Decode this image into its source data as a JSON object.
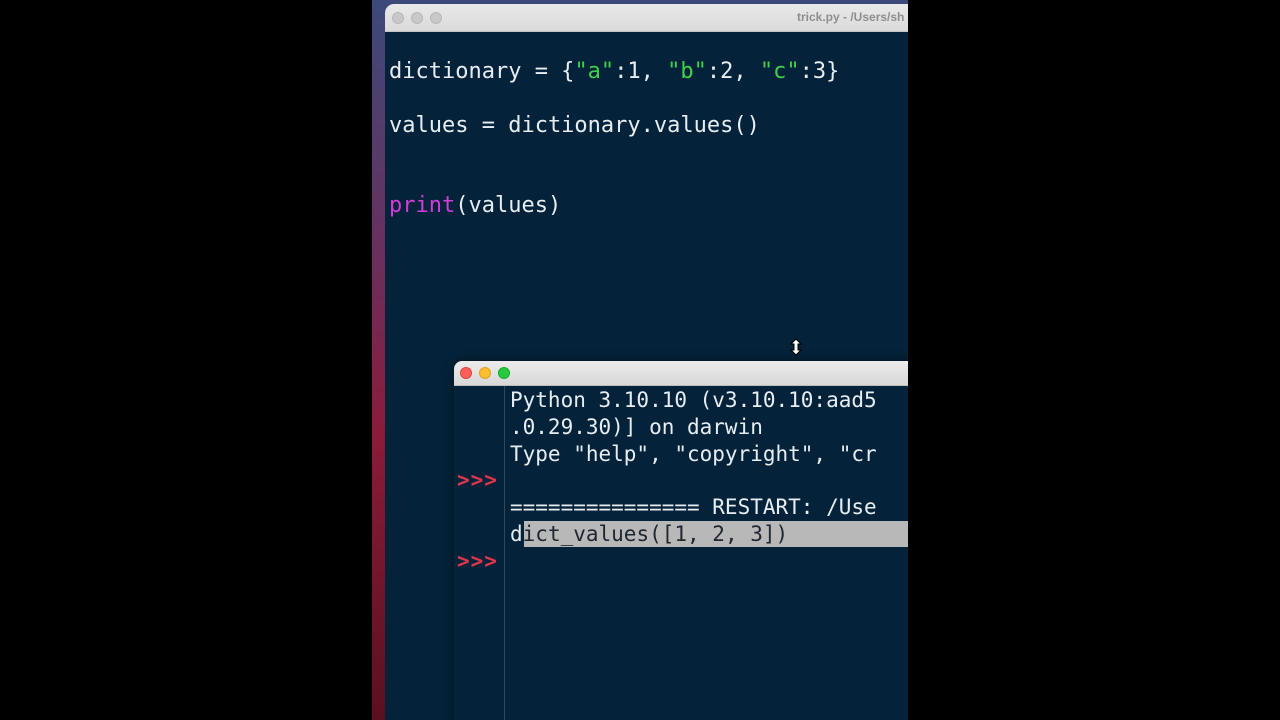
{
  "editor": {
    "title": "trick.py - /Users/sh",
    "lines": {
      "l1_a": "dictionary = {",
      "l1_s1": "\"a\"",
      "l1_b": ":1, ",
      "l1_s2": "\"b\"",
      "l1_c": ":2, ",
      "l1_s3": "\"c\"",
      "l1_d": ":3}",
      "l2": "values = dictionary.values()",
      "l3_kw": "print",
      "l3_rest": "(values)"
    }
  },
  "shell": {
    "out1": "Python 3.10.10 (v3.10.10:aad5",
    "out2": ".0.29.30)] on darwin",
    "out3": "Type \"help\", \"copyright\", \"cr",
    "out4": "=============== RESTART: /Use",
    "out5_first": "d",
    "out5_rest": "ict_values([1, 2, 3])",
    "prompt": ">>>"
  },
  "colors": {
    "string": "#3fd14b",
    "keyword": "#d13bd8",
    "prompt": "#e0344a",
    "background": "#04233a"
  },
  "icons": {
    "cursor": "resize-vertical-cursor-icon"
  }
}
